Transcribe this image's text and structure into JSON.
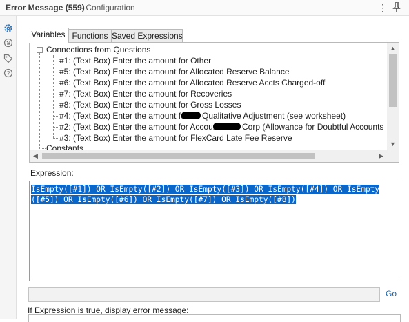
{
  "header": {
    "title": "Error Message (559)",
    "subtitle": "- Configuration"
  },
  "tabs": [
    {
      "label": "Variables",
      "active": true
    },
    {
      "label": "Functions",
      "active": false
    },
    {
      "label": "Saved Expressions",
      "active": false
    }
  ],
  "tree": {
    "group_label": "Connections from Questions",
    "items": [
      "#1: (Text Box) Enter the amount for Other",
      "#5: (Text Box) Enter the amount for Allocated Reserve Balance",
      "#6: (Text Box) Enter the amount for Allocated Reserve Accts Charged-off",
      "#7: (Text Box) Enter the amount for Recoveries",
      "#8: (Text Box) Enter the amount for Gross Losses",
      "#4: (Text Box) Enter the amount for",
      "#2: (Text Box) Enter the amount for Account",
      "#3: (Text Box) Enter the amount for FlexCard Late Fee Reserve"
    ],
    "item4_suffix": "Qualitative Adjustment (see worksheet)",
    "item2_suffix": "Corp   (Allowance for Doubtful Accounts",
    "constants_label": "Constants"
  },
  "expression": {
    "label": "Expression:",
    "line1": "IsEmpty([#1]) OR IsEmpty([#2]) OR IsEmpty([#3]) OR IsEmpty([#4]) OR IsEmpty",
    "line2": "([#5]) OR IsEmpty([#6]) OR IsEmpty([#7]) OR IsEmpty([#8])"
  },
  "go_label": "Go",
  "error_label": "If Expression is true, display error message:",
  "colors": {
    "selection": "#0a66c8",
    "go_text": "#1f63a8"
  }
}
